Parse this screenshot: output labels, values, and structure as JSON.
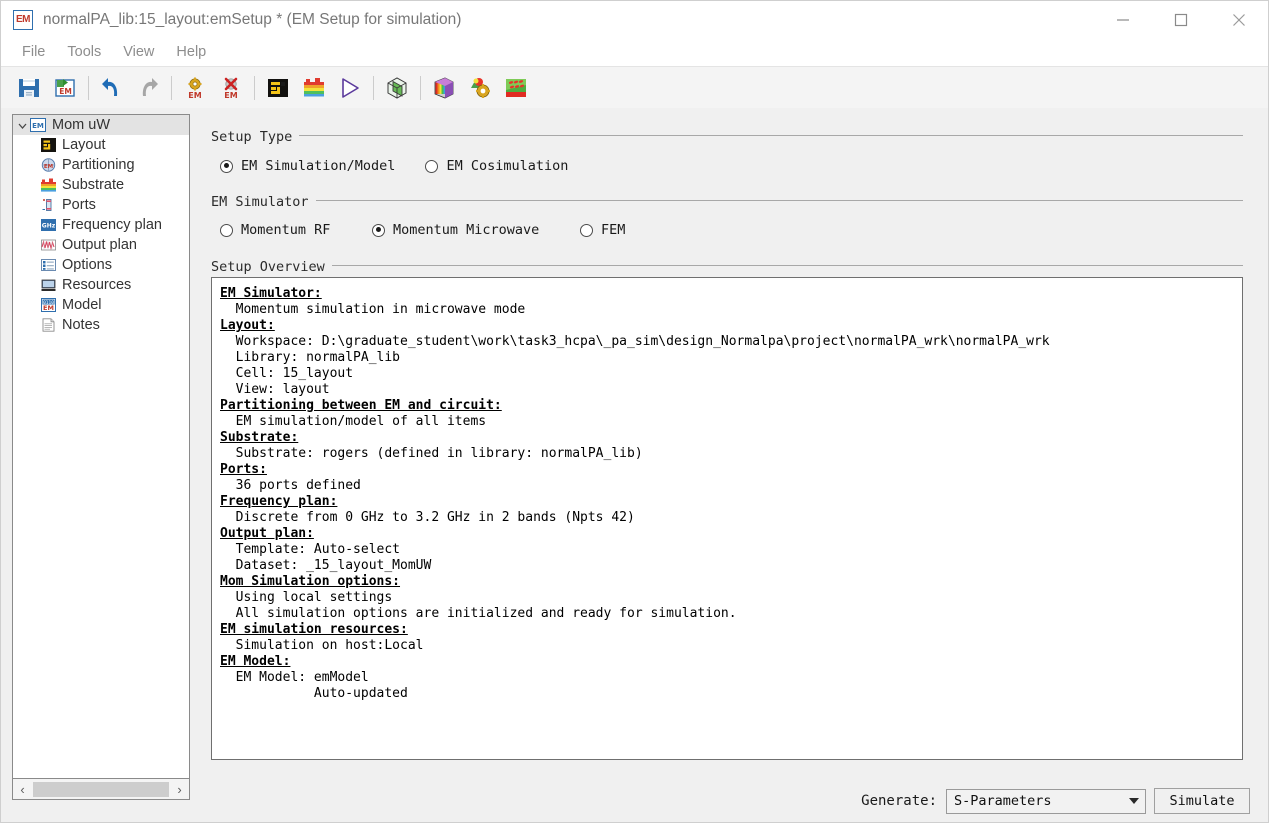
{
  "window": {
    "icon": "em-app-icon",
    "title": "normalPA_lib:15_layout:emSetup * (EM Setup for simulation)",
    "controls": {
      "minimize": "minimize-icon",
      "maximize": "maximize-icon",
      "close": "close-icon"
    }
  },
  "menu": {
    "items": [
      {
        "label": "File"
      },
      {
        "label": "Tools"
      },
      {
        "label": "View"
      },
      {
        "label": "Help"
      }
    ]
  },
  "toolbar": {
    "buttons": [
      {
        "name": "save-icon"
      },
      {
        "name": "save-em-icon"
      },
      {
        "name": "undo-icon"
      },
      {
        "name": "redo-icon"
      },
      {
        "name": "em-settings-icon"
      },
      {
        "name": "em-delete-icon"
      },
      {
        "name": "layout-icon"
      },
      {
        "name": "substrate-icon"
      },
      {
        "name": "simulate-play-icon"
      },
      {
        "name": "mesh-cube-icon"
      },
      {
        "name": "rainbow-cube-icon"
      },
      {
        "name": "em-model-gear-icon"
      },
      {
        "name": "field-visualization-icon"
      }
    ]
  },
  "sidebar": {
    "root": {
      "label": "Mom uW",
      "icon": "em-icon",
      "expanded": true
    },
    "items": [
      {
        "label": "Layout",
        "icon": "layout-icon"
      },
      {
        "label": "Partitioning",
        "icon": "partitioning-icon"
      },
      {
        "label": "Substrate",
        "icon": "substrate-icon"
      },
      {
        "label": "Ports",
        "icon": "ports-icon"
      },
      {
        "label": "Frequency plan",
        "icon": "ghz-icon"
      },
      {
        "label": "Output plan",
        "icon": "output-plan-icon"
      },
      {
        "label": "Options",
        "icon": "options-icon"
      },
      {
        "label": "Resources",
        "icon": "resources-icon"
      },
      {
        "label": "Model",
        "icon": "model-icon"
      },
      {
        "label": "Notes",
        "icon": "notes-icon"
      }
    ],
    "hscroll": {
      "left_arrow": "‹",
      "right_arrow": "›"
    }
  },
  "setup_type": {
    "group_title": "Setup Type",
    "options": [
      {
        "label": "EM Simulation/Model",
        "selected": true
      },
      {
        "label": "EM Cosimulation",
        "selected": false
      }
    ]
  },
  "em_simulator": {
    "group_title": "EM Simulator",
    "options": [
      {
        "label": "Momentum RF",
        "selected": false
      },
      {
        "label": "Momentum Microwave",
        "selected": true
      },
      {
        "label": "FEM",
        "selected": false
      }
    ]
  },
  "setup_overview": {
    "group_title": "Setup Overview",
    "lines": [
      {
        "text": "EM Simulator:",
        "head": true
      },
      {
        "text": "  Momentum simulation in microwave mode",
        "head": false
      },
      {
        "text": "Layout:",
        "head": true
      },
      {
        "text": "  Workspace: D:\\graduate_student\\work\\task3_hcpa\\_pa_sim\\design_Normalpa\\project\\normalPA_wrk\\normalPA_wrk",
        "head": false
      },
      {
        "text": "  Library: normalPA_lib",
        "head": false
      },
      {
        "text": "  Cell: 15_layout",
        "head": false
      },
      {
        "text": "  View: layout",
        "head": false
      },
      {
        "text": "Partitioning between EM and circuit:",
        "head": true
      },
      {
        "text": "  EM simulation/model of all items",
        "head": false
      },
      {
        "text": "Substrate:",
        "head": true
      },
      {
        "text": "  Substrate: rogers (defined in library: normalPA_lib)",
        "head": false
      },
      {
        "text": "Ports:",
        "head": true
      },
      {
        "text": "  36 ports defined",
        "head": false
      },
      {
        "text": "Frequency plan:",
        "head": true
      },
      {
        "text": "  Discrete from 0 GHz to 3.2 GHz in 2 bands (Npts 42)",
        "head": false
      },
      {
        "text": "Output plan:",
        "head": true
      },
      {
        "text": "  Template: Auto-select",
        "head": false
      },
      {
        "text": "  Dataset: _15_layout_MomUW",
        "head": false
      },
      {
        "text": "Mom Simulation options:",
        "head": true
      },
      {
        "text": "  Using local settings",
        "head": false
      },
      {
        "text": "  All simulation options are initialized and ready for simulation.",
        "head": false
      },
      {
        "text": "EM simulation resources:",
        "head": true
      },
      {
        "text": "  Simulation on host:Local",
        "head": false
      },
      {
        "text": "EM Model:",
        "head": true
      },
      {
        "text": "  EM Model: emModel",
        "head": false
      },
      {
        "text": "            Auto-updated",
        "head": false
      }
    ]
  },
  "bottom": {
    "generate_label": "Generate:",
    "generate_value": "S-Parameters",
    "simulate_label": "Simulate"
  },
  "colors": {
    "accent_blue": "#2f6fae",
    "em_red": "#c0392b",
    "panel_bg": "#f0f0f0",
    "selection_grey": "#e3e3e3"
  }
}
